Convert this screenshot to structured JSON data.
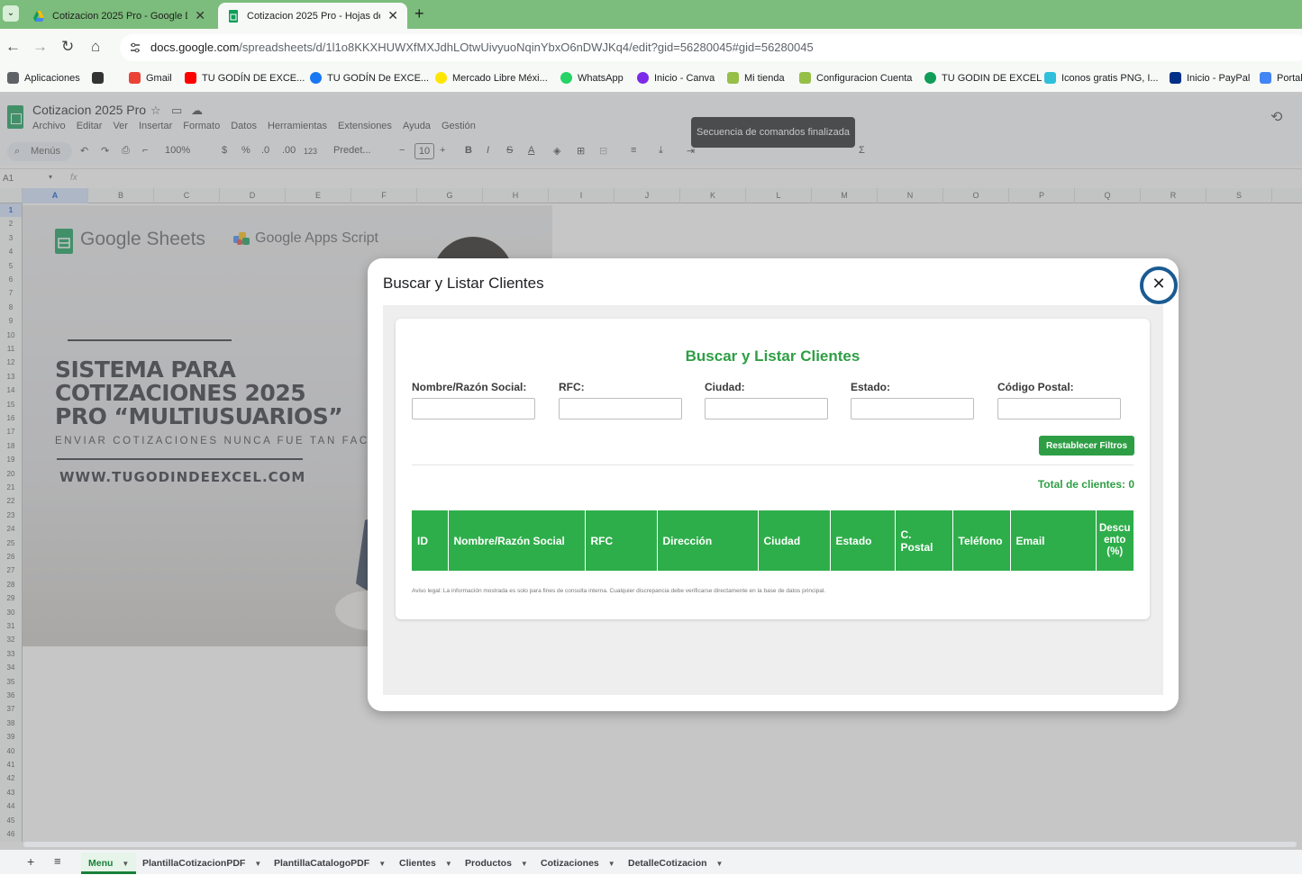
{
  "browser": {
    "tabs": [
      {
        "title": "Cotizacion 2025 Pro - Google D",
        "active": false,
        "favicon": "google-drive-icon"
      },
      {
        "title": "Cotizacion 2025 Pro - Hojas de",
        "active": true,
        "favicon": "google-sheets-icon"
      }
    ],
    "url_host": "docs.google.com",
    "url_path": "/spreadsheets/d/1l1o8KKXHUWXfMXJdhLOtwUivyuoNqinYbxO6nDWJKq4/edit?gid=56280045#gid=56280045",
    "bookmarks": [
      {
        "label": "Aplicaciones",
        "icon": "apps-grid-icon",
        "color": "#5f6368"
      },
      {
        "label": "",
        "icon": "grid-icon",
        "color": "#333333"
      },
      {
        "label": "Gmail",
        "icon": "gmail-icon",
        "color": "#ea4335"
      },
      {
        "label": "TU GODÍN DE EXCE...",
        "icon": "youtube-icon",
        "color": "#ff0000"
      },
      {
        "label": "TU GODÍN De EXCE...",
        "icon": "facebook-icon",
        "color": "#1877f2"
      },
      {
        "label": "Mercado Libre Méxi...",
        "icon": "mercadolibre-icon",
        "color": "#ffe600"
      },
      {
        "label": "WhatsApp",
        "icon": "whatsapp-icon",
        "color": "#25d366"
      },
      {
        "label": "Inicio - Canva",
        "icon": "canva-icon",
        "color": "#7d2ae8"
      },
      {
        "label": "Mi tienda",
        "icon": "shopify-icon",
        "color": "#95bf47"
      },
      {
        "label": "Configuracion Cuenta",
        "icon": "shopify-icon",
        "color": "#95bf47"
      },
      {
        "label": "TU GODIN DE EXCEL",
        "icon": "site-icon",
        "color": "#0f9d58"
      },
      {
        "label": "Iconos gratis PNG, I...",
        "icon": "flaticon-icon",
        "color": "#2fbfda"
      },
      {
        "label": "Inicio - PayPal",
        "icon": "paypal-icon",
        "color": "#003087"
      },
      {
        "label": "Portal",
        "icon": "portal-icon",
        "color": "#4285f4"
      }
    ]
  },
  "sheets": {
    "doc_title": "Cotizacion 2025 Pro",
    "menu": [
      "Archivo",
      "Editar",
      "Ver",
      "Insertar",
      "Formato",
      "Datos",
      "Herramientas",
      "Extensiones",
      "Ayuda",
      "Gestión"
    ],
    "toolbar": {
      "menus_label": "Menús",
      "zoom": "100%",
      "currency": "$",
      "percent": "%",
      "dec_less": ".0",
      "dec_more": ".00",
      "format_123": "123",
      "font": "Predet...",
      "font_size": "10"
    },
    "tooltip": "Secuencia de comandos finalizada",
    "name_box": "A1",
    "fx": "fx",
    "columns": [
      "A",
      "B",
      "C",
      "D",
      "E",
      "F",
      "G",
      "H",
      "I",
      "J",
      "K",
      "L",
      "M",
      "N",
      "O",
      "P",
      "Q",
      "R",
      "S"
    ],
    "rows": [
      "1",
      "2",
      "3",
      "4",
      "5",
      "6",
      "7",
      "8",
      "9",
      "10",
      "11",
      "12",
      "13",
      "14",
      "15",
      "16",
      "17",
      "18",
      "19",
      "20",
      "21",
      "22",
      "23",
      "24",
      "25",
      "26",
      "27",
      "28",
      "29",
      "30",
      "31",
      "32",
      "33",
      "34",
      "35",
      "36",
      "37",
      "38",
      "39",
      "40",
      "41",
      "42",
      "43",
      "44",
      "45",
      "46"
    ],
    "sheet_tabs": [
      {
        "label": "Menu",
        "active": true
      },
      {
        "label": "PlantillaCotizacionPDF",
        "active": false
      },
      {
        "label": "PlantillaCatalogoPDF",
        "active": false
      },
      {
        "label": "Clientes",
        "active": false
      },
      {
        "label": "Productos",
        "active": false
      },
      {
        "label": "Cotizaciones",
        "active": false
      },
      {
        "label": "DetalleCotizacion",
        "active": false
      }
    ]
  },
  "banner": {
    "google_sheets": "Google Sheets",
    "google_apps_script": "Google Apps Script",
    "headline": [
      "SISTEMA PARA",
      "COTIZACIONES 2025",
      "PRO “MULTIUSUARIOS”"
    ],
    "subtitle": "ENVIAR COTIZACIONES NUNCA FUE TAN FACIL",
    "url": "WWW.TUGODINDEEXCEL.COM"
  },
  "dialog": {
    "title": "Buscar y Listar Clientes",
    "card_title": "Buscar y Listar Clientes",
    "filters": [
      {
        "label": "Nombre/Razón Social:",
        "value": ""
      },
      {
        "label": "RFC:",
        "value": ""
      },
      {
        "label": "Ciudad:",
        "value": ""
      },
      {
        "label": "Estado:",
        "value": ""
      },
      {
        "label": "Código Postal:",
        "value": ""
      }
    ],
    "reset_label": "Restablecer Filtros",
    "total_label": "Total de clientes: 0",
    "table_headers": [
      "ID",
      "Nombre/Razón Social",
      "RFC",
      "Dirección",
      "Ciudad",
      "Estado",
      "C. Postal",
      "Teléfono",
      "Email",
      "Descuento (%)"
    ],
    "legal": "Aviso legal: La información mostrada es solo para fines de consulta interna. Cualquier discrepancia debe verificarse directamente en la base de datos principal.",
    "accent_color": "#2e9e44"
  }
}
